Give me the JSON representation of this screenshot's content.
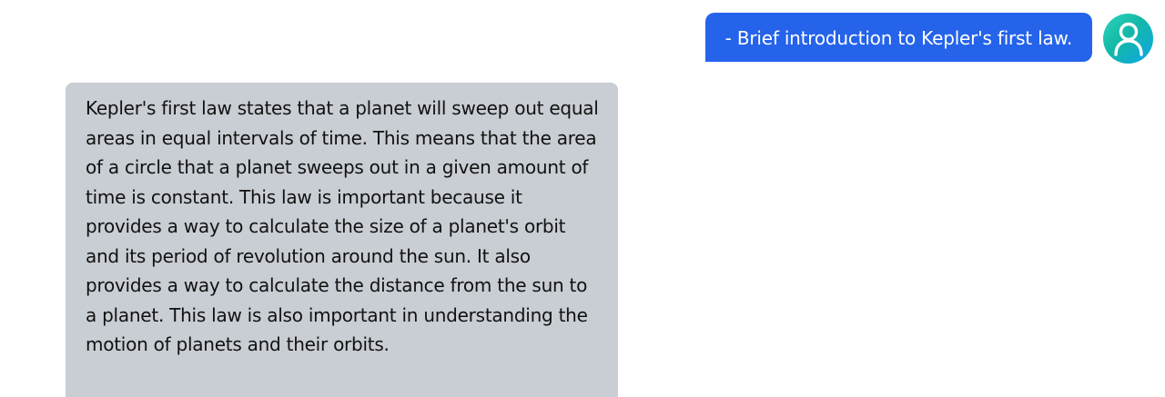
{
  "conversation": {
    "user_message": "- Brief introduction to Kepler's first law.",
    "assistant_message": "Kepler's first law states that a planet will sweep out equal areas in equal intervals of time. This means that the area of a circle that a planet sweeps out in a given amount of time is constant. This law is important because it provides a way to calculate the size of a planet's orbit and its period of revolution around the sun. It also provides a way to calculate the distance from the sun to a planet. This law is also important in understanding the motion of planets and their orbits."
  },
  "icons": {
    "avatar": "user-icon"
  },
  "colors": {
    "user_bubble": "#2563eb",
    "assistant_bubble": "#c9cdd4",
    "avatar_gradient_start": "#2dd4bf",
    "avatar_gradient_end": "#0ea5e9"
  }
}
